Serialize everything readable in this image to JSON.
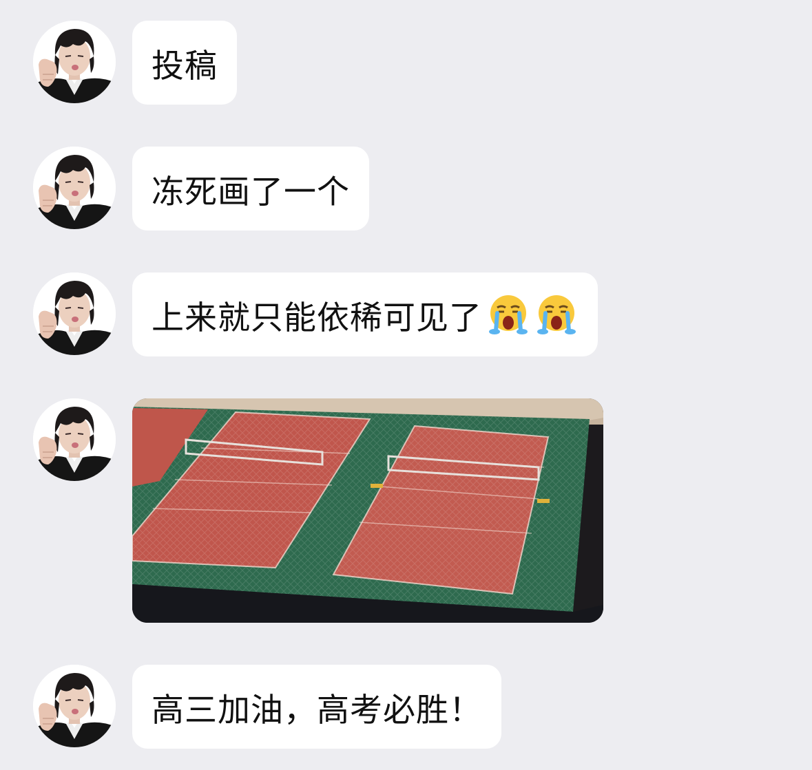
{
  "messages": [
    {
      "avatar": "user-avatar",
      "type": "text",
      "text": "投稿"
    },
    {
      "avatar": "user-avatar",
      "type": "text",
      "text": "冻死画了一个"
    },
    {
      "avatar": "user-avatar",
      "type": "text",
      "text": "上来就只能依稀可见了",
      "emojis": [
        "loudly-crying-face-icon",
        "loudly-crying-face-icon"
      ]
    },
    {
      "avatar": "user-avatar",
      "type": "image",
      "image": "badminton-court-drawing"
    },
    {
      "avatar": "user-avatar",
      "type": "text",
      "text": "高三加油，高考必胜！"
    }
  ],
  "colors": {
    "background": "#ededf1",
    "bubble": "#ffffff",
    "text": "#111111",
    "court_red": "#c0564c",
    "court_green": "#2e6a4e"
  }
}
